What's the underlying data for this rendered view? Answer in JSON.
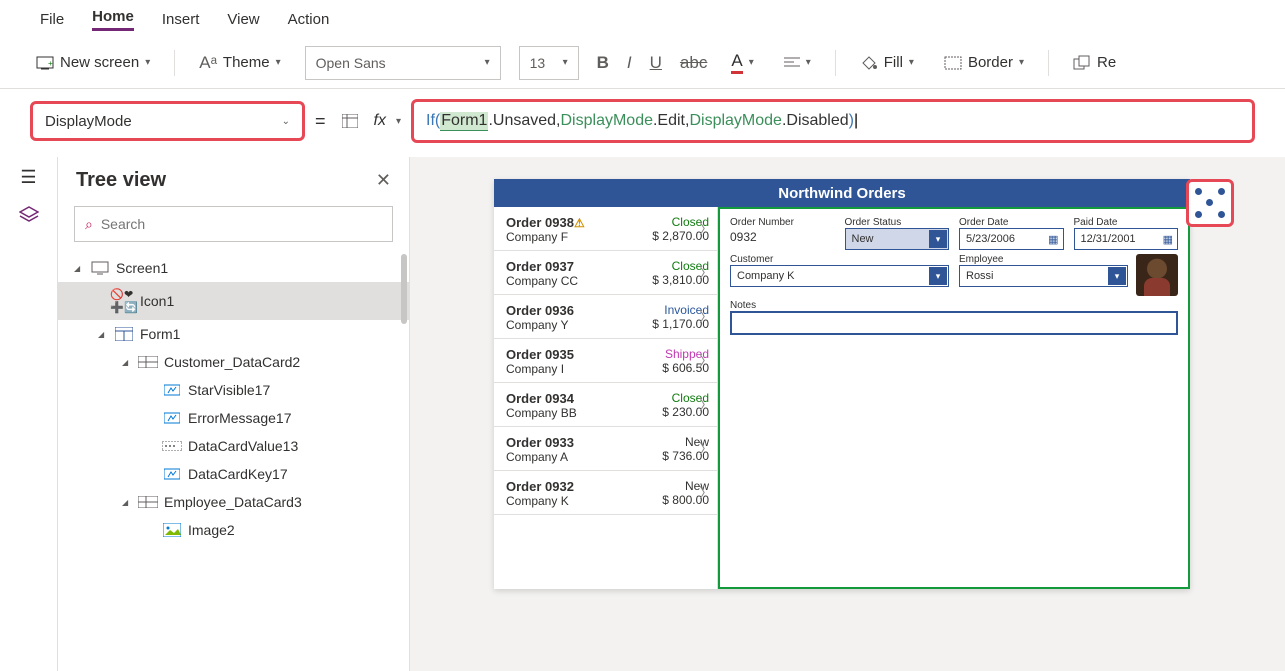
{
  "menubar": {
    "items": [
      "File",
      "Home",
      "Insert",
      "View",
      "Action"
    ],
    "activeIndex": 1
  },
  "ribbon": {
    "newScreen": "New screen",
    "theme": "Theme",
    "font": "Open Sans",
    "fontSize": "13",
    "fill": "Fill",
    "border": "Border",
    "reorder": "Re"
  },
  "property": {
    "name": "DisplayMode"
  },
  "formula": {
    "parts": [
      {
        "t": "If(",
        "c": "kw"
      },
      {
        "t": " "
      },
      {
        "t": "Form1",
        "c": "hl"
      },
      {
        "t": ".Unsaved, ",
        "c": "mem"
      },
      {
        "t": "DisplayMode",
        "c": "enm"
      },
      {
        "t": ".Edit, ",
        "c": "mem"
      },
      {
        "t": "DisplayMode",
        "c": "enm"
      },
      {
        "t": ".Disabled ",
        "c": "mem"
      },
      {
        "t": ")",
        "c": "kw"
      }
    ]
  },
  "tree": {
    "title": "Tree view",
    "searchPlaceholder": "Search",
    "items": [
      {
        "label": "Screen1",
        "icon": "screen",
        "indent": 0,
        "exp": true
      },
      {
        "label": "Icon1",
        "icon": "iconset",
        "indent": 1,
        "sel": true
      },
      {
        "label": "Form1",
        "icon": "form",
        "indent": 1,
        "exp": true
      },
      {
        "label": "Customer_DataCard2",
        "icon": "card",
        "indent": 2,
        "exp": true
      },
      {
        "label": "StarVisible17",
        "icon": "label",
        "indent": 3
      },
      {
        "label": "ErrorMessage17",
        "icon": "label",
        "indent": 3
      },
      {
        "label": "DataCardValue13",
        "icon": "input",
        "indent": 3
      },
      {
        "label": "DataCardKey17",
        "icon": "label",
        "indent": 3
      },
      {
        "label": "Employee_DataCard3",
        "icon": "card",
        "indent": 2,
        "exp": true
      },
      {
        "label": "Image2",
        "icon": "image",
        "indent": 3
      }
    ]
  },
  "app": {
    "title": "Northwind Orders",
    "orders": [
      {
        "no": "Order 0938",
        "warn": true,
        "company": "Company F",
        "status": "Closed",
        "sc": "closed",
        "amount": "$ 2,870.00"
      },
      {
        "no": "Order 0937",
        "company": "Company CC",
        "status": "Closed",
        "sc": "closed",
        "amount": "$ 3,810.00"
      },
      {
        "no": "Order 0936",
        "company": "Company Y",
        "status": "Invoiced",
        "sc": "invoiced",
        "amount": "$ 1,170.00"
      },
      {
        "no": "Order 0935",
        "company": "Company I",
        "status": "Shipped",
        "sc": "shipped",
        "amount": "$ 606.50"
      },
      {
        "no": "Order 0934",
        "company": "Company BB",
        "status": "Closed",
        "sc": "closed",
        "amount": "$ 230.00"
      },
      {
        "no": "Order 0933",
        "company": "Company A",
        "status": "New",
        "sc": "new",
        "amount": "$ 736.00"
      },
      {
        "no": "Order 0932",
        "company": "Company K",
        "status": "New",
        "sc": "new",
        "amount": "$ 800.00"
      }
    ],
    "form": {
      "labels": {
        "orderNumber": "Order Number",
        "orderStatus": "Order Status",
        "orderDate": "Order Date",
        "paidDate": "Paid Date",
        "customer": "Customer",
        "employee": "Employee",
        "notes": "Notes"
      },
      "values": {
        "orderNumber": "0932",
        "orderStatus": "New",
        "orderDate": "5/23/2006",
        "paidDate": "12/31/2001",
        "customer": "Company K",
        "employee": "Rossi"
      }
    }
  }
}
